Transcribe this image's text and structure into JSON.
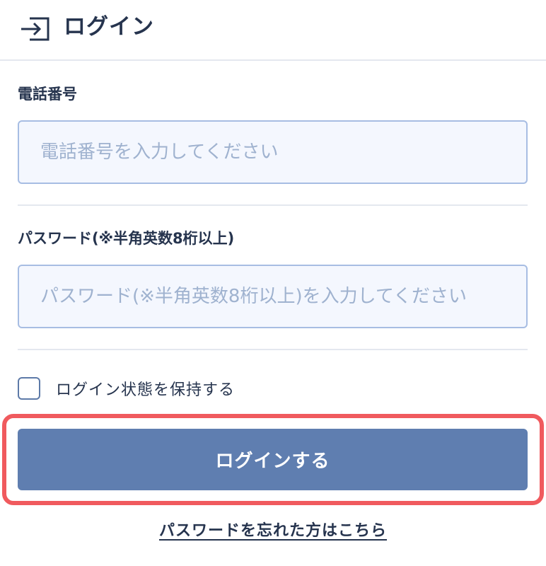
{
  "header": {
    "title": "ログイン",
    "icon": "login-icon"
  },
  "form": {
    "phone": {
      "label": "電話番号",
      "value": "",
      "placeholder": "電話番号を入力してください"
    },
    "password": {
      "label": "パスワード(※半角英数8桁以上)",
      "value": "",
      "placeholder": "パスワード(※半角英数8桁以上)を入力してください"
    },
    "remember": {
      "label": "ログイン状態を保持する",
      "checked": false
    },
    "submit_label": "ログインする",
    "forgot_label": "パスワードを忘れた方はこちら"
  },
  "colors": {
    "text": "#26344e",
    "input_border": "#a7bde3",
    "input_background": "#f4f7fe",
    "placeholder": "#9fb2cf",
    "button": "#5f7eb0",
    "highlight": "#f05a5e",
    "divider": "#e4e8ef"
  }
}
